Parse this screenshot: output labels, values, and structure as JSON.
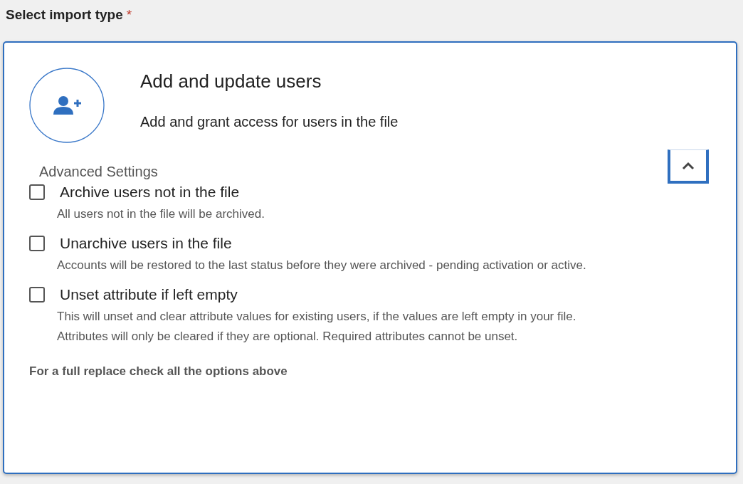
{
  "field": {
    "label": "Select import type",
    "required_mark": "*"
  },
  "option": {
    "title": "Add and update users",
    "description": "Add and grant access for users in the file",
    "selected": true
  },
  "advanced": {
    "label": "Advanced Settings",
    "expanded": true,
    "settings": [
      {
        "label": "Archive users not in the file",
        "checked": false,
        "description": [
          "All users not in the file will be archived."
        ]
      },
      {
        "label": "Unarchive users in the file",
        "checked": false,
        "description": [
          "Accounts will be restored to the last status before they were archived - pending activation or active."
        ]
      },
      {
        "label": "Unset attribute if left empty",
        "checked": false,
        "description": [
          "This will unset and clear attribute values for existing users, if the values are left empty in your file.",
          "Attributes will only be cleared if they are optional. Required attributes cannot be unset."
        ]
      }
    ],
    "note": "For a full replace check all the options above"
  }
}
